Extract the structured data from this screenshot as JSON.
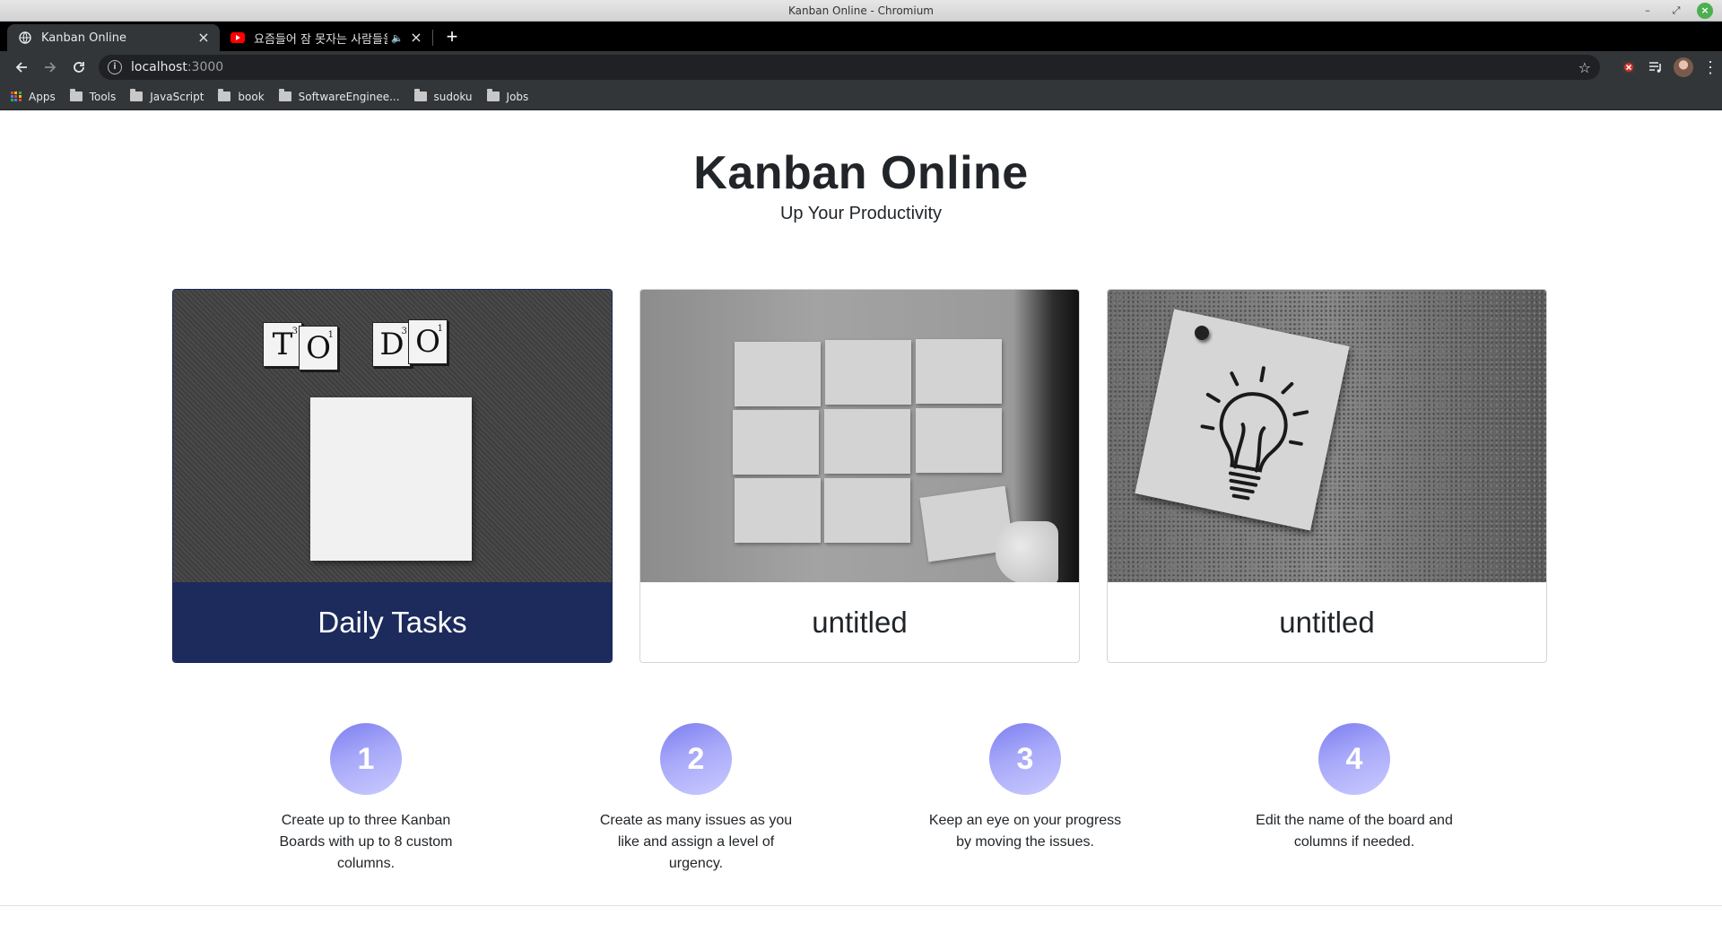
{
  "window": {
    "title": "Kanban Online - Chromium"
  },
  "tabs": [
    {
      "label": "Kanban Online",
      "icon": "globe-icon",
      "active": true
    },
    {
      "label": "요즘들어 잠 못자는 사람들을",
      "icon": "youtube-icon",
      "active": false
    }
  ],
  "address": {
    "host": "localhost",
    "port": ":3000"
  },
  "bookmarks": [
    {
      "label": "Apps",
      "icon": "apps-grid-icon"
    },
    {
      "label": "Tools",
      "icon": "folder-icon"
    },
    {
      "label": "JavaScript",
      "icon": "folder-icon"
    },
    {
      "label": "book",
      "icon": "folder-icon"
    },
    {
      "label": "SoftwareEnginee...",
      "icon": "folder-icon"
    },
    {
      "label": "sudoku",
      "icon": "folder-icon"
    },
    {
      "label": "Jobs",
      "icon": "folder-icon"
    }
  ],
  "hero": {
    "title": "Kanban Online",
    "subtitle": "Up Your Productivity"
  },
  "boards": [
    {
      "name": "Daily Tasks",
      "image": "todo-note-image",
      "selected": true
    },
    {
      "name": "untitled",
      "image": "sticky-notes-wall-image",
      "selected": false
    },
    {
      "name": "untitled",
      "image": "lightbulb-note-image",
      "selected": false
    }
  ],
  "steps": [
    {
      "number": "1",
      "text": "Create up to three Kanban Boards with up to 8 custom columns."
    },
    {
      "number": "2",
      "text": "Create as many issues as you like and assign a level of urgency."
    },
    {
      "number": "3",
      "text": "Keep an eye on your progress by moving the issues."
    },
    {
      "number": "4",
      "text": "Edit the name of the board and columns if needed."
    }
  ],
  "colors": {
    "selected_card": "#1c2a5c",
    "step_circle_start": "#7c7ef0",
    "step_circle_end": "#c9caff"
  }
}
